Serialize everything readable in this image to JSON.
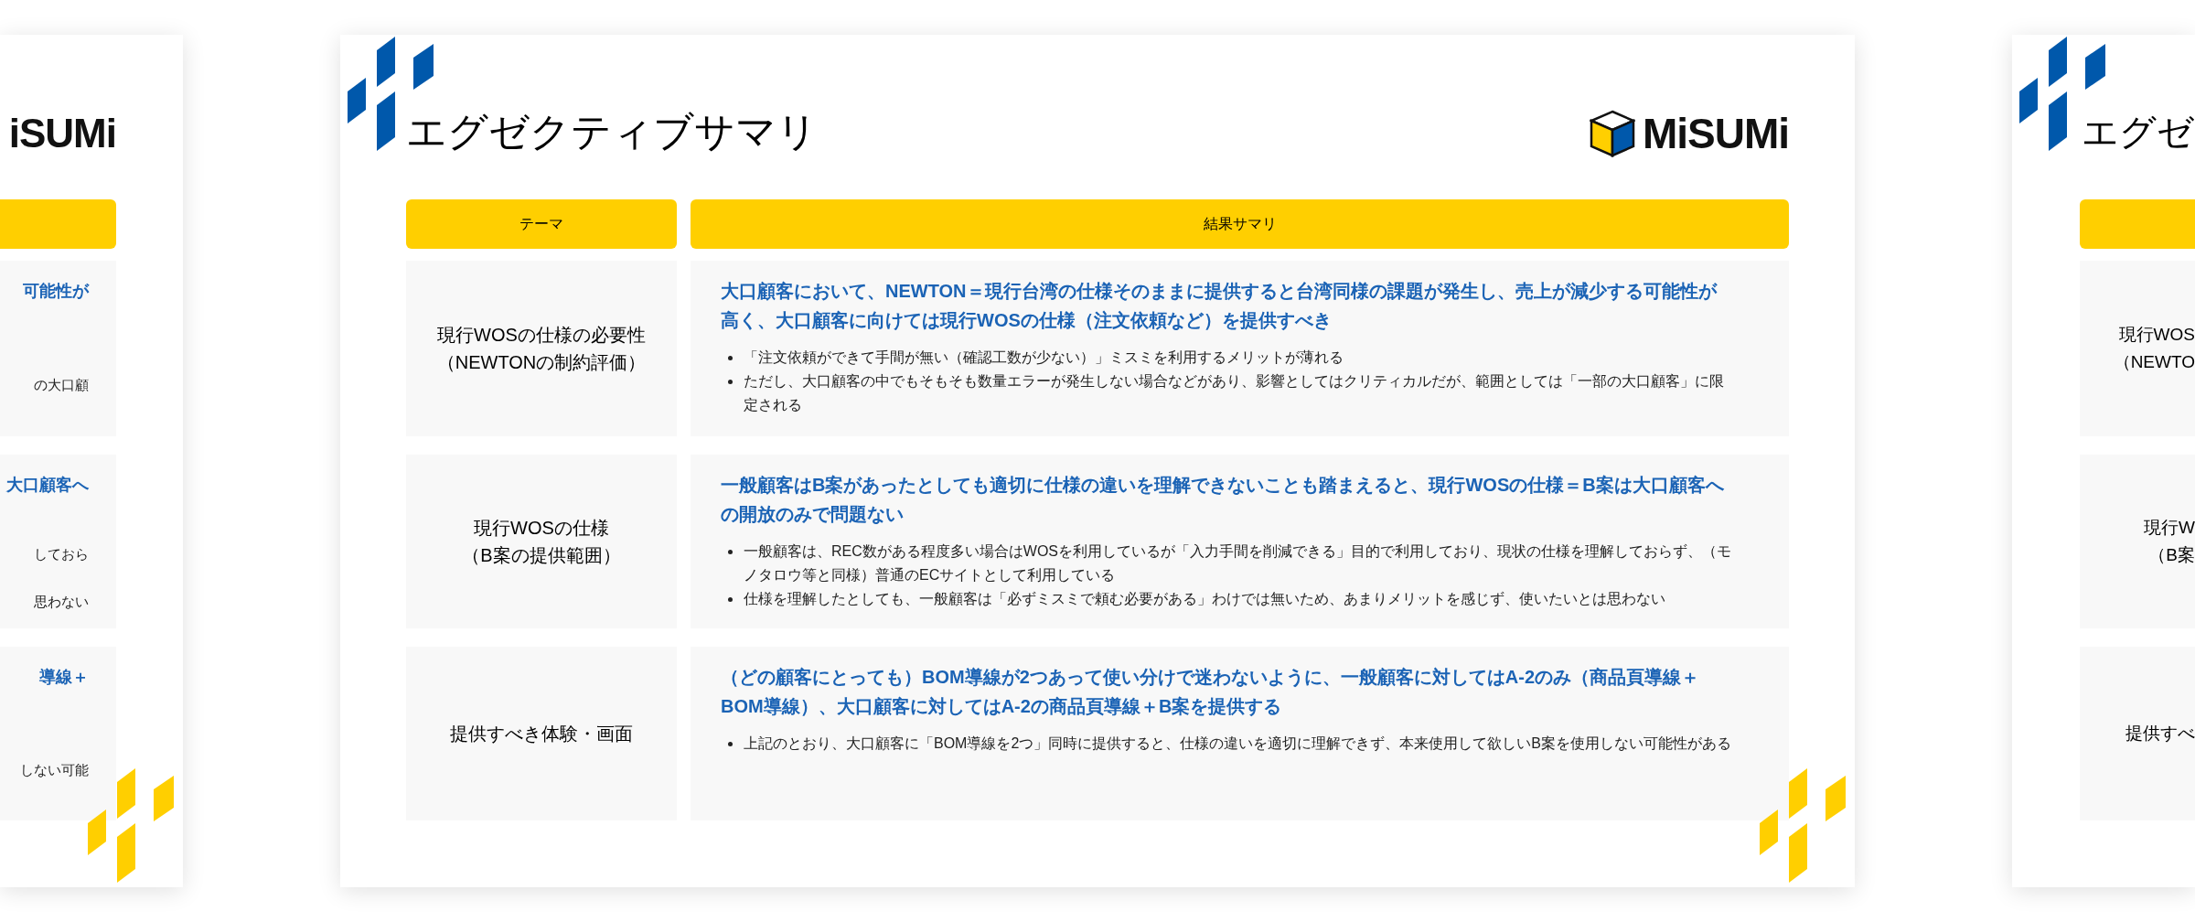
{
  "slides": [
    {
      "kind": "partial-left",
      "logo_text": "iSUMi",
      "rows": [
        {
          "heading": "可能性が",
          "bullets": [
            "の大口顧"
          ]
        },
        {
          "heading": "大口顧客へ",
          "bullets": [
            "しておら",
            "思わない"
          ]
        },
        {
          "heading": "導線＋",
          "bullets": [
            "しない可能"
          ]
        }
      ]
    },
    {
      "kind": "full",
      "title": "エグゼクティブサマリ",
      "logo_text": "MiSUMi",
      "columns": [
        "テーマ",
        "結果サマリ"
      ],
      "rows": [
        {
          "theme": [
            "現行WOSの仕様の必要性",
            "（NEWTONの制約評価）"
          ],
          "heading": "大口顧客において、NEWTON＝現行台湾の仕様そのままに提供すると台湾同様の課題が発生し、売上が減少する可能性が高く、大口顧客に向けては現行WOSの仕様（注文依頼など）を提供すべき",
          "bullets": [
            "「注文依頼ができて手間が無い（確認工数が少ない）」ミスミを利用するメリットが薄れる",
            "ただし、大口顧客の中でもそもそも数量エラーが発生しない場合などがあり、影響としてはクリティカルだが、範囲としては「一部の大口顧客」に限定される"
          ]
        },
        {
          "theme": [
            "現行WOSの仕様",
            "（B案の提供範囲）"
          ],
          "heading": "一般顧客はB案があったとしても適切に仕様の違いを理解できないことも踏まえると、現行WOSの仕様＝B案は大口顧客への開放のみで問題ない",
          "bullets": [
            "一般顧客は、REC数がある程度多い場合はWOSを利用しているが「入力手間を削減できる」目的で利用しており、現状の仕様を理解しておらず、（モノタロウ等と同様）普通のECサイトとして利用している",
            "仕様を理解したとしても、一般顧客は「必ずミスミで頼む必要がある」わけでは無いため、あまりメリットを感じず、使いたいとは思わない"
          ]
        },
        {
          "theme": [
            "提供すべき体験・画面"
          ],
          "heading": "（どの顧客にとっても）BOM導線が2つあって使い分けで迷わないように、一般顧客に対してはA-2のみ（商品頁導線＋BOM導線）、大口顧客に対してはA-2の商品頁導線＋B案を提供する",
          "bullets": [
            "上記のとおり、大口顧客に「BOM導線を2つ」同時に提供すると、仕様の違いを適切に理解できず、本来使用して欲しいB案を使用しない可能性がある"
          ]
        }
      ]
    },
    {
      "kind": "partial-right",
      "title": "エグゼ",
      "rows": [
        {
          "theme": [
            "現行WOS",
            "（NEWTO"
          ]
        },
        {
          "theme": [
            "現行W",
            "（B案"
          ]
        },
        {
          "theme": [
            "提供すべ"
          ]
        }
      ]
    }
  ]
}
